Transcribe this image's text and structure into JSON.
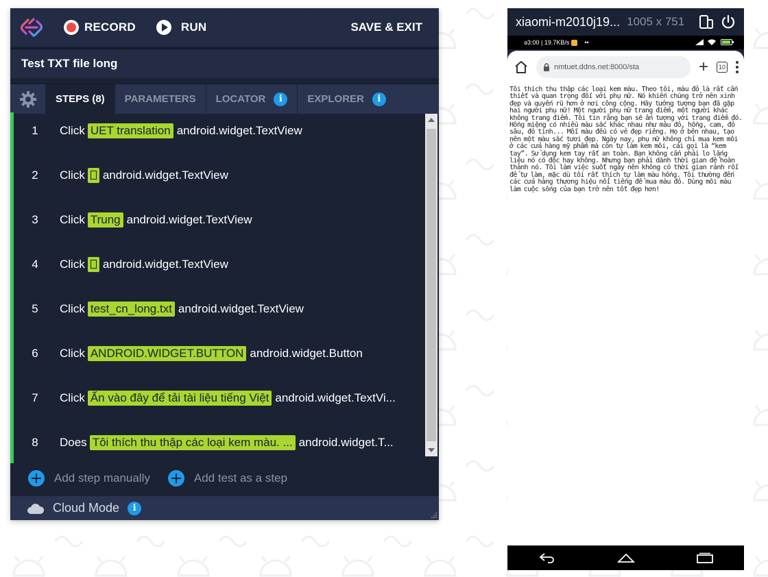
{
  "colors": {
    "panel_bg": "#1b2234",
    "panel_header": "#232c44",
    "accent_green": "#39c85e",
    "highlight": "#a9d630",
    "info_blue": "#1e9be9",
    "record_red": "#ef4a4a"
  },
  "toolbar": {
    "record_label": "RECORD",
    "run_label": "RUN",
    "save_exit_label": "SAVE & EXIT"
  },
  "test": {
    "name": "Test TXT file long"
  },
  "tabs": [
    {
      "label": "STEPS (8)",
      "active": true
    },
    {
      "label": "PARAMETERS",
      "active": false
    },
    {
      "label": "LOCATOR",
      "active": false,
      "icon": "info-icon"
    },
    {
      "label": "EXPLORER",
      "active": false,
      "icon": "info-icon"
    }
  ],
  "steps": [
    {
      "num": "1",
      "action": "Click",
      "target": "UET translation",
      "element": "android.widget.TextView"
    },
    {
      "num": "2",
      "action": "Click",
      "target": "",
      "element": "android.widget.TextView"
    },
    {
      "num": "3",
      "action": "Click",
      "target": "Trung",
      "element": "android.widget.TextView"
    },
    {
      "num": "4",
      "action": "Click",
      "target": "",
      "element": "android.widget.TextView"
    },
    {
      "num": "5",
      "action": "Click",
      "target": "test_cn_long.txt",
      "element": "android.widget.TextView"
    },
    {
      "num": "6",
      "action": "Click",
      "target": "ANDROID.WIDGET.BUTTON",
      "element": "android.widget.Button"
    },
    {
      "num": "7",
      "action": "Click",
      "target": "Ấn vào đây để tải tài liệu tiếng Việt",
      "element": "android.widget.TextVi..."
    },
    {
      "num": "8",
      "action": "Does",
      "target": "Tôi thích thu thập các loại kem màu. ...",
      "element": "android.widget.T..."
    }
  ],
  "add": {
    "manual_label": "Add step manually",
    "test_label": "Add test as a step"
  },
  "cloud": {
    "label": "Cloud Mode"
  },
  "device": {
    "name": "xiaomi-m2010j19...",
    "resolution": "1005 x 751",
    "status_left": "ə3:00 | 19.7KB/s",
    "status_dots": "••",
    "url": "nmtuet.ddns.net:8000/sta",
    "tab_count": "10",
    "page_text": "Tôi thích thu thập các loại kem màu. Theo tôi, màu đỏ là rất cần thiết và quan trọng đối với phụ nữ. Nó khiến chúng trở nên xinh đẹp và quyến rũ hơn ở nơi công cộng. Hãy tưởng tượng bạn đã gặp hai người phụ nữ! Một người phụ nữ trang điểm, một người khác không trang điểm. Tôi tin rằng bạn sẽ ấn tượng với trang điểm đó. Hồng miệng có nhiều màu sắc khác nhau như màu đỏ, hồng, cam, đỏ sâu, đỏ tinh... Mỗi màu đều có vẻ đẹp riêng. Họ ở bên nhau, tạo nên một màu sắc tươi đẹp. Ngày nay, phụ nữ không chỉ mua kem môi ở các cửa hàng mỹ phẩm mà còn tự làm kem môi, cái gọi là “kem tay”. Sử dụng kem tay rất an toàn. Bạn không cần phải lo lắng liệu nó có độc hay không. Nhưng bạn phải dành thời gian để hoàn thành nó. Tôi làm việc suốt ngày nên không có thời gian rảnh rỗi để tự làm, mặc dù tôi rất thích tự làm màu hồng. Tôi thường đến các cửa hàng thương hiệu nổi tiếng để mua màu đỏ. Dùng môi màu làm cuộc sống của bạn trở nên tốt đẹp hơn!"
  }
}
